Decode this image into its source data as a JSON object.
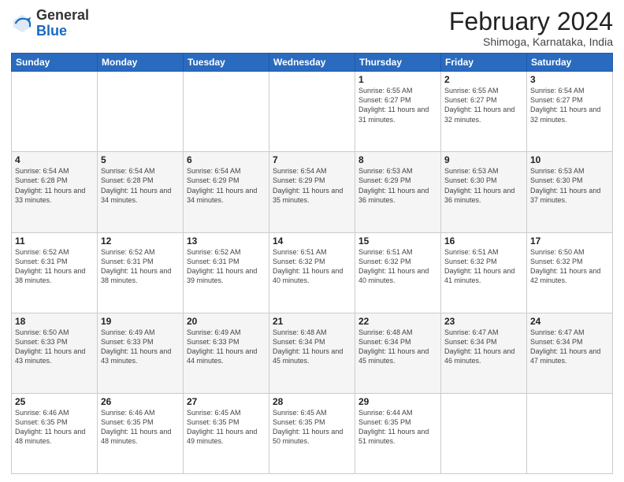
{
  "logo": {
    "general": "General",
    "blue": "Blue"
  },
  "header": {
    "month": "February 2024",
    "location": "Shimoga, Karnataka, India"
  },
  "weekdays": [
    "Sunday",
    "Monday",
    "Tuesday",
    "Wednesday",
    "Thursday",
    "Friday",
    "Saturday"
  ],
  "weeks": [
    [
      {
        "day": "",
        "info": ""
      },
      {
        "day": "",
        "info": ""
      },
      {
        "day": "",
        "info": ""
      },
      {
        "day": "",
        "info": ""
      },
      {
        "day": "1",
        "info": "Sunrise: 6:55 AM\nSunset: 6:27 PM\nDaylight: 11 hours and 31 minutes."
      },
      {
        "day": "2",
        "info": "Sunrise: 6:55 AM\nSunset: 6:27 PM\nDaylight: 11 hours and 32 minutes."
      },
      {
        "day": "3",
        "info": "Sunrise: 6:54 AM\nSunset: 6:27 PM\nDaylight: 11 hours and 32 minutes."
      }
    ],
    [
      {
        "day": "4",
        "info": "Sunrise: 6:54 AM\nSunset: 6:28 PM\nDaylight: 11 hours and 33 minutes."
      },
      {
        "day": "5",
        "info": "Sunrise: 6:54 AM\nSunset: 6:28 PM\nDaylight: 11 hours and 34 minutes."
      },
      {
        "day": "6",
        "info": "Sunrise: 6:54 AM\nSunset: 6:29 PM\nDaylight: 11 hours and 34 minutes."
      },
      {
        "day": "7",
        "info": "Sunrise: 6:54 AM\nSunset: 6:29 PM\nDaylight: 11 hours and 35 minutes."
      },
      {
        "day": "8",
        "info": "Sunrise: 6:53 AM\nSunset: 6:29 PM\nDaylight: 11 hours and 36 minutes."
      },
      {
        "day": "9",
        "info": "Sunrise: 6:53 AM\nSunset: 6:30 PM\nDaylight: 11 hours and 36 minutes."
      },
      {
        "day": "10",
        "info": "Sunrise: 6:53 AM\nSunset: 6:30 PM\nDaylight: 11 hours and 37 minutes."
      }
    ],
    [
      {
        "day": "11",
        "info": "Sunrise: 6:52 AM\nSunset: 6:31 PM\nDaylight: 11 hours and 38 minutes."
      },
      {
        "day": "12",
        "info": "Sunrise: 6:52 AM\nSunset: 6:31 PM\nDaylight: 11 hours and 38 minutes."
      },
      {
        "day": "13",
        "info": "Sunrise: 6:52 AM\nSunset: 6:31 PM\nDaylight: 11 hours and 39 minutes."
      },
      {
        "day": "14",
        "info": "Sunrise: 6:51 AM\nSunset: 6:32 PM\nDaylight: 11 hours and 40 minutes."
      },
      {
        "day": "15",
        "info": "Sunrise: 6:51 AM\nSunset: 6:32 PM\nDaylight: 11 hours and 40 minutes."
      },
      {
        "day": "16",
        "info": "Sunrise: 6:51 AM\nSunset: 6:32 PM\nDaylight: 11 hours and 41 minutes."
      },
      {
        "day": "17",
        "info": "Sunrise: 6:50 AM\nSunset: 6:32 PM\nDaylight: 11 hours and 42 minutes."
      }
    ],
    [
      {
        "day": "18",
        "info": "Sunrise: 6:50 AM\nSunset: 6:33 PM\nDaylight: 11 hours and 43 minutes."
      },
      {
        "day": "19",
        "info": "Sunrise: 6:49 AM\nSunset: 6:33 PM\nDaylight: 11 hours and 43 minutes."
      },
      {
        "day": "20",
        "info": "Sunrise: 6:49 AM\nSunset: 6:33 PM\nDaylight: 11 hours and 44 minutes."
      },
      {
        "day": "21",
        "info": "Sunrise: 6:48 AM\nSunset: 6:34 PM\nDaylight: 11 hours and 45 minutes."
      },
      {
        "day": "22",
        "info": "Sunrise: 6:48 AM\nSunset: 6:34 PM\nDaylight: 11 hours and 45 minutes."
      },
      {
        "day": "23",
        "info": "Sunrise: 6:47 AM\nSunset: 6:34 PM\nDaylight: 11 hours and 46 minutes."
      },
      {
        "day": "24",
        "info": "Sunrise: 6:47 AM\nSunset: 6:34 PM\nDaylight: 11 hours and 47 minutes."
      }
    ],
    [
      {
        "day": "25",
        "info": "Sunrise: 6:46 AM\nSunset: 6:35 PM\nDaylight: 11 hours and 48 minutes."
      },
      {
        "day": "26",
        "info": "Sunrise: 6:46 AM\nSunset: 6:35 PM\nDaylight: 11 hours and 48 minutes."
      },
      {
        "day": "27",
        "info": "Sunrise: 6:45 AM\nSunset: 6:35 PM\nDaylight: 11 hours and 49 minutes."
      },
      {
        "day": "28",
        "info": "Sunrise: 6:45 AM\nSunset: 6:35 PM\nDaylight: 11 hours and 50 minutes."
      },
      {
        "day": "29",
        "info": "Sunrise: 6:44 AM\nSunset: 6:35 PM\nDaylight: 11 hours and 51 minutes."
      },
      {
        "day": "",
        "info": ""
      },
      {
        "day": "",
        "info": ""
      }
    ]
  ]
}
